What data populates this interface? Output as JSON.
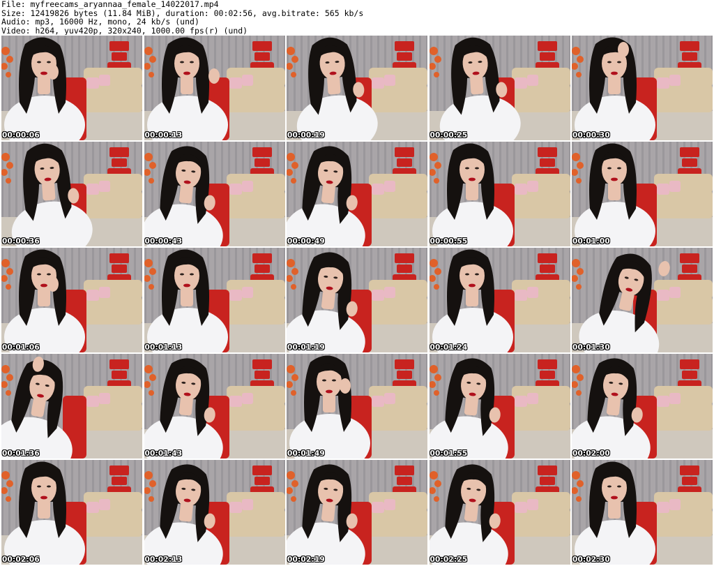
{
  "header": {
    "file": "File: myfreecams_aryannaa_female_14022017.mp4",
    "size": "Size: 12419826 bytes (11.84 MiB), duration: 00:02:56, avg.bitrate: 565 kb/s",
    "audio": "Audio: mp3, 16000 Hz, mono, 24 kb/s (und)",
    "video": "Video: h264, yuv420p, 320x240, 1000.00 fps(r) (und)"
  },
  "thumbnails": [
    {
      "timestamp": "00:00:06",
      "pose": "hand-left-face"
    },
    {
      "timestamp": "00:00:13",
      "pose": "hand-raised"
    },
    {
      "timestamp": "00:00:19",
      "pose": "turned-right"
    },
    {
      "timestamp": "00:00:25",
      "pose": "turned-right"
    },
    {
      "timestamp": "00:00:30",
      "pose": "hand-head"
    },
    {
      "timestamp": "00:00:36",
      "pose": "turned-right"
    },
    {
      "timestamp": "00:00:43",
      "pose": "looking-down"
    },
    {
      "timestamp": "00:00:49",
      "pose": "looking-down"
    },
    {
      "timestamp": "00:00:55",
      "pose": "frontal"
    },
    {
      "timestamp": "00:01:00",
      "pose": "frontal"
    },
    {
      "timestamp": "00:01:06",
      "pose": "hand-face"
    },
    {
      "timestamp": "00:01:13",
      "pose": "frontal"
    },
    {
      "timestamp": "00:01:19",
      "pose": "looking-down"
    },
    {
      "timestamp": "00:01:24",
      "pose": "frontal"
    },
    {
      "timestamp": "00:01:30",
      "pose": "arm-up"
    },
    {
      "timestamp": "00:01:36",
      "pose": "arm-up-left"
    },
    {
      "timestamp": "00:01:43",
      "pose": "looking-down"
    },
    {
      "timestamp": "00:01:49",
      "pose": "hand-ear"
    },
    {
      "timestamp": "00:01:55",
      "pose": "looking-down"
    },
    {
      "timestamp": "00:02:00",
      "pose": "looking-down"
    },
    {
      "timestamp": "00:02:06",
      "pose": "frontal"
    },
    {
      "timestamp": "00:02:13",
      "pose": "looking-down"
    },
    {
      "timestamp": "00:02:19",
      "pose": "looking-down"
    },
    {
      "timestamp": "00:02:25",
      "pose": "looking-down"
    },
    {
      "timestamp": "00:02:30",
      "pose": "frontal"
    }
  ],
  "colors": {
    "wall": "#a9a5a8",
    "sofa": "#d9c7a6",
    "chair": "#c8231f",
    "shirt": "#f4f4f6",
    "hair": "#15110f",
    "skin": "#e8c2ae",
    "lips": "#b0101c",
    "floor": "#cfc8bd",
    "flowers": "#e0612a"
  }
}
